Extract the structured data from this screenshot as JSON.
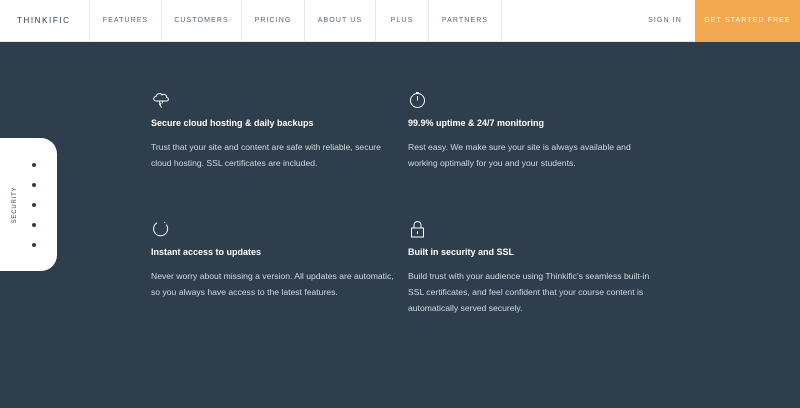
{
  "nav": {
    "logo": "THINKIFIC",
    "items": [
      "FEATURES",
      "CUSTOMERS",
      "PRICING",
      "ABOUT US",
      "PLUS",
      "PARTNERS"
    ],
    "sign_in": "SIGN IN",
    "cta": "GET STARTED FREE"
  },
  "sidebar": {
    "label": "SECURITY",
    "dot_count": 5
  },
  "features": [
    {
      "icon": "cloud-icon",
      "title": "Secure cloud hosting & daily backups",
      "description": "Trust that your site and content are safe with reliable, secure cloud hosting. SSL certificates are included."
    },
    {
      "icon": "stopwatch-icon",
      "title": "99.9% uptime & 24/7 monitoring",
      "description": "Rest easy. We make sure your site is always available and working optimally for you and your students."
    },
    {
      "icon": "refresh-icon",
      "title": "Instant access to updates",
      "description": "Never worry about missing a version. All updates are automatic, so you always have access to the latest features."
    },
    {
      "icon": "lock-icon",
      "title": "Built in security and SSL",
      "description": "Build trust with your audience using Thinkific's seamless built-in SSL certificates, and feel confident that your course content is automatically served securely."
    }
  ],
  "colors": {
    "background": "#2e3e4c",
    "cta": "#f2a84e",
    "nav_bg": "#ffffff"
  }
}
